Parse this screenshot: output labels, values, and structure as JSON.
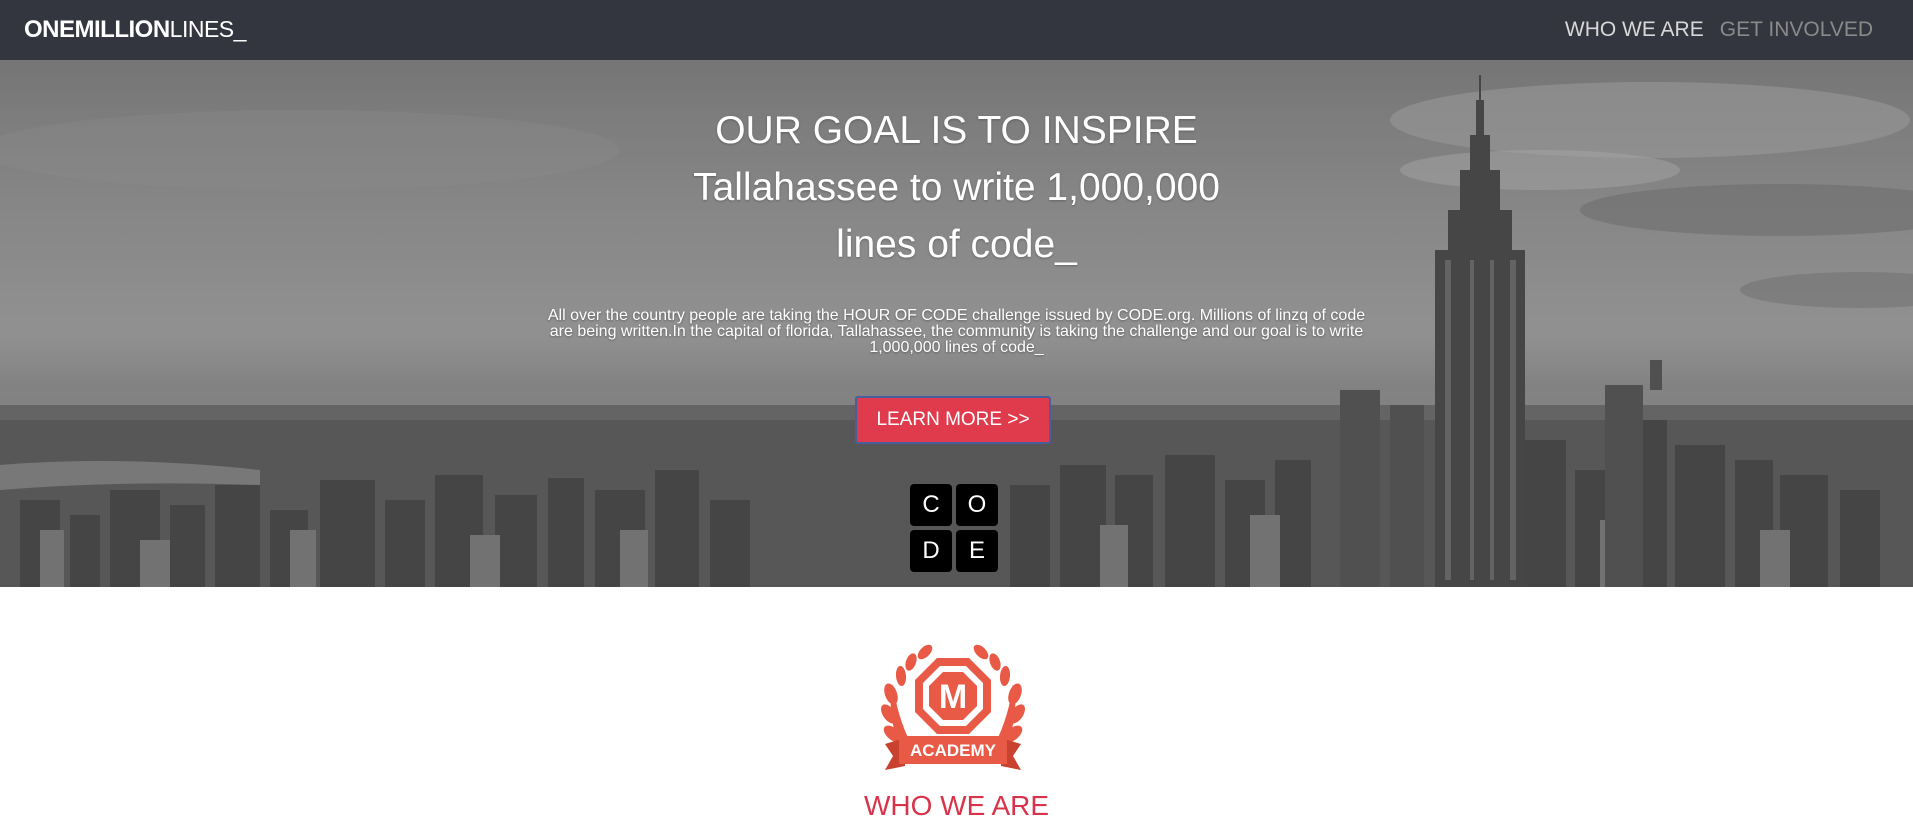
{
  "navbar": {
    "brand_bold": "ONEMILLION",
    "brand_light": "LINES_",
    "links": [
      {
        "label": "WHO WE ARE"
      },
      {
        "label": "GET INVOLVED"
      }
    ]
  },
  "hero": {
    "title_lines": [
      "OUR GOAL IS TO INSPIRE",
      "Tallahassee to write 1,000,000",
      "lines of code_"
    ],
    "description": "All over the country people are taking the HOUR OF CODE challenge issued by CODE.org. Millions of linzq of code are being written.In the capital of florida, Tallahassee, the community is taking the challenge and our goal is to write 1,000,000 lines of code_",
    "button_label": "LEARN MORE >>",
    "code_letters": [
      "C",
      "O",
      "D",
      "E"
    ]
  },
  "about": {
    "badge_letter": "M",
    "badge_ribbon": "ACADEMY",
    "title": "WHO WE ARE"
  },
  "colors": {
    "navbar_bg": "#33363e",
    "accent_red": "#e03b4d",
    "title_red": "#d8334a",
    "badge_red": "#e85a45"
  }
}
